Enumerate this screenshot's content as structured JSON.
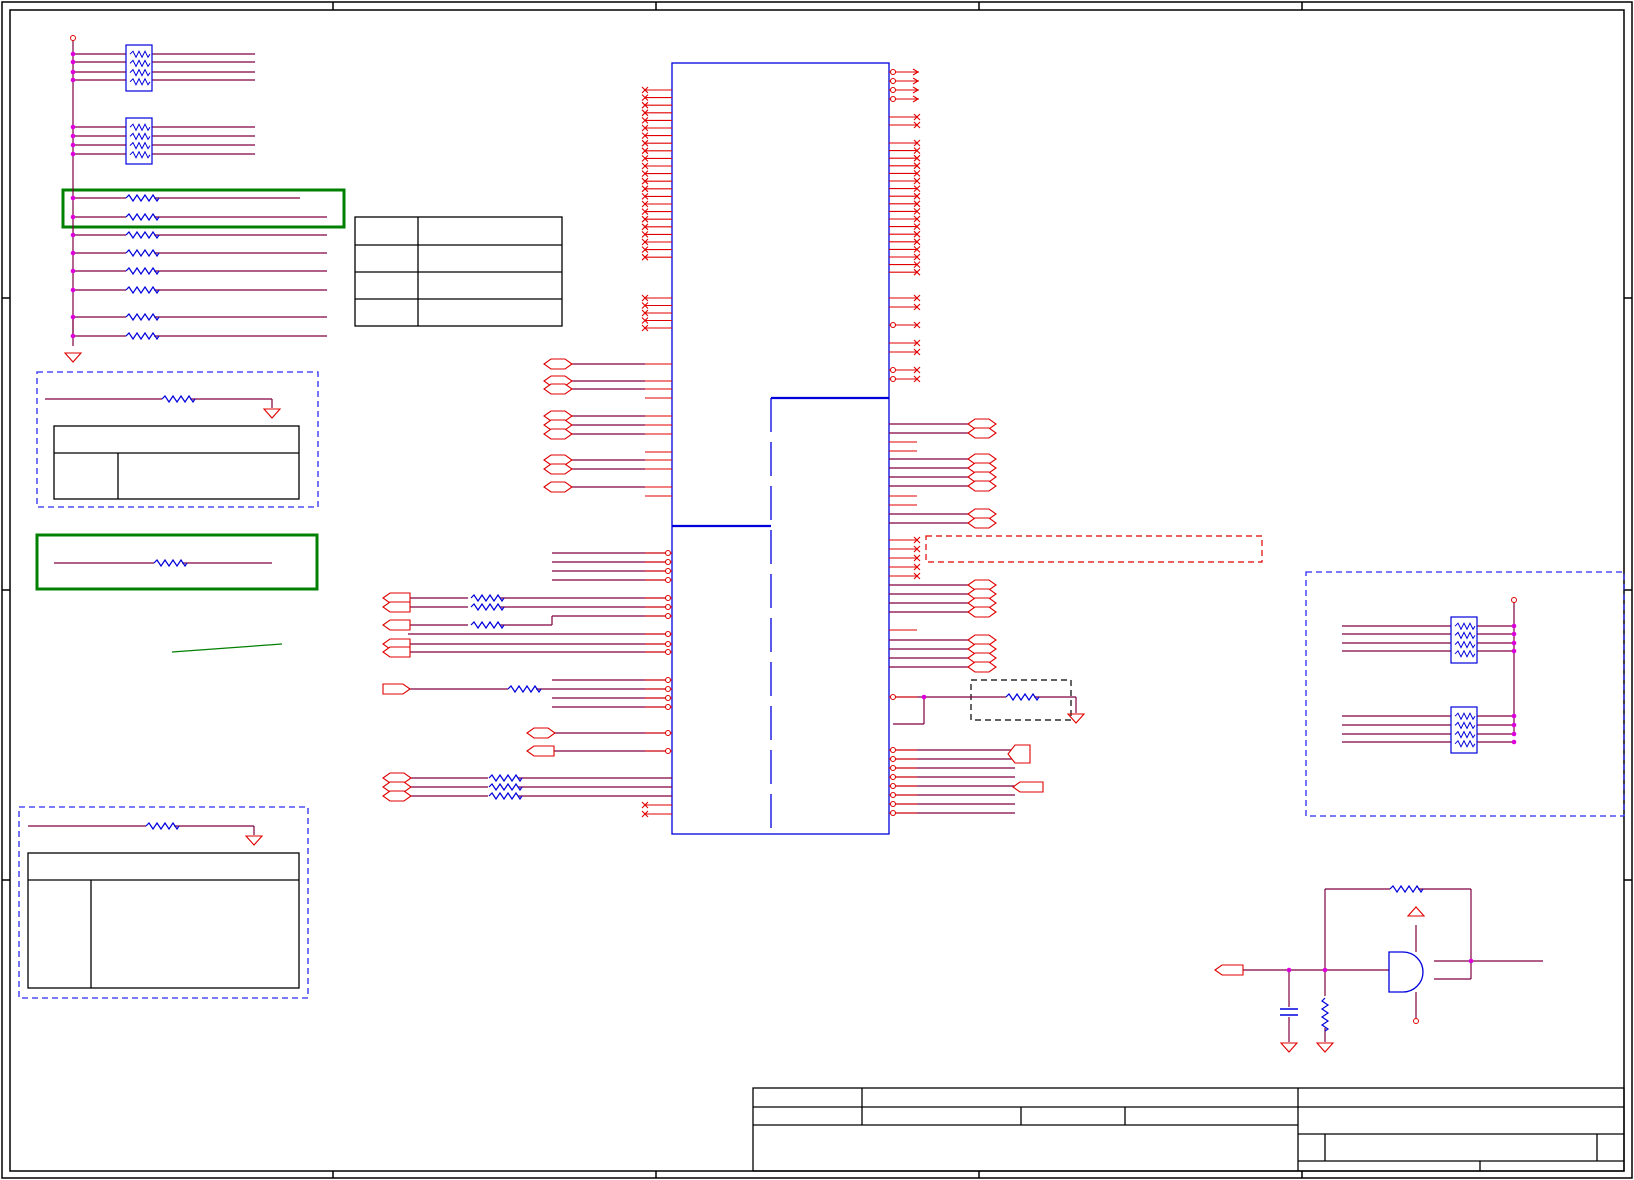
{
  "sheet": {
    "title": "",
    "zone_labels": []
  },
  "colors": {
    "background": "#ffffff",
    "border": "#000000",
    "wire": "#800040",
    "pin": "#e00000",
    "component": "#0000dd",
    "junction": "#dd00dd",
    "highlight_box": "#008000",
    "note_box": "#2a2af0",
    "dashed_red": "#e00000",
    "dashed_black": "#000000"
  },
  "icons": {
    "resistor": "resistor-icon",
    "resistor_pack": "resistor-pack-icon",
    "ground": "ground-symbol",
    "power": "power-symbol",
    "and_gate": "and-gate-icon",
    "capacitor": "capacitor-icon",
    "port": "port-connector"
  }
}
